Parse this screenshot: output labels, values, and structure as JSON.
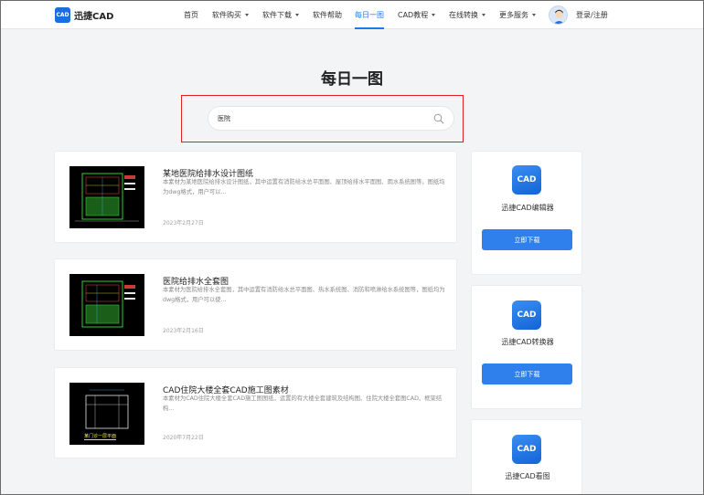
{
  "header": {
    "logo_text": "迅捷CAD",
    "logo_mark": "CAD",
    "nav": [
      {
        "label": "首页"
      },
      {
        "label": "软件购买"
      },
      {
        "label": "软件下载"
      },
      {
        "label": "软件帮助"
      },
      {
        "label": "每日一图"
      },
      {
        "label": "CAD教程"
      },
      {
        "label": "在线转换"
      },
      {
        "label": "更多服务"
      }
    ],
    "login_label": "登录/注册"
  },
  "page_title": "每日一图",
  "search": {
    "value": "医院"
  },
  "results": [
    {
      "title": "某地医院给排水设计图纸",
      "desc": "本素材为某地医院给排水设计图纸，其中运置有消防给水总平面图、屋顶给排水平面图、雨水系统图等。图纸均为dwg格式，用户可以...",
      "date": "2023年2月27日"
    },
    {
      "title": "医院给排水全套图",
      "desc": "本素材为医院给排水全套图，其中运置有消防给水总平面图、热水系统图、消防和喷淋给水系统图等，图纸均为dwg格式，用户可以使...",
      "date": "2023年2月16日"
    },
    {
      "title": "CAD住院大楼全套CAD施工图素材",
      "desc": "本素材为CAD住院大楼全套CAD施工图图纸，运置的有大楼全套建筑及结构图、住院大楼全套图CAD、框架结构...",
      "date": "2020年7月22日",
      "thumb_caption": "某门诊一层平面"
    }
  ],
  "sidebar": [
    {
      "icon": "cad-editor-icon",
      "icon_text": "CAD",
      "name": "迅捷CAD编辑器",
      "button": "立即下载"
    },
    {
      "icon": "cad-converter-icon",
      "icon_text": "CAD",
      "name": "迅捷CAD转换器",
      "button": "立即下载"
    },
    {
      "icon": "cad-viewer-icon",
      "icon_text": "CAD",
      "name": "迅捷CAD看图"
    }
  ],
  "colors": {
    "accent": "#1b7ae6",
    "button": "#2f80ed",
    "highlight_box": "#e02020",
    "background": "#f3f4f6"
  }
}
